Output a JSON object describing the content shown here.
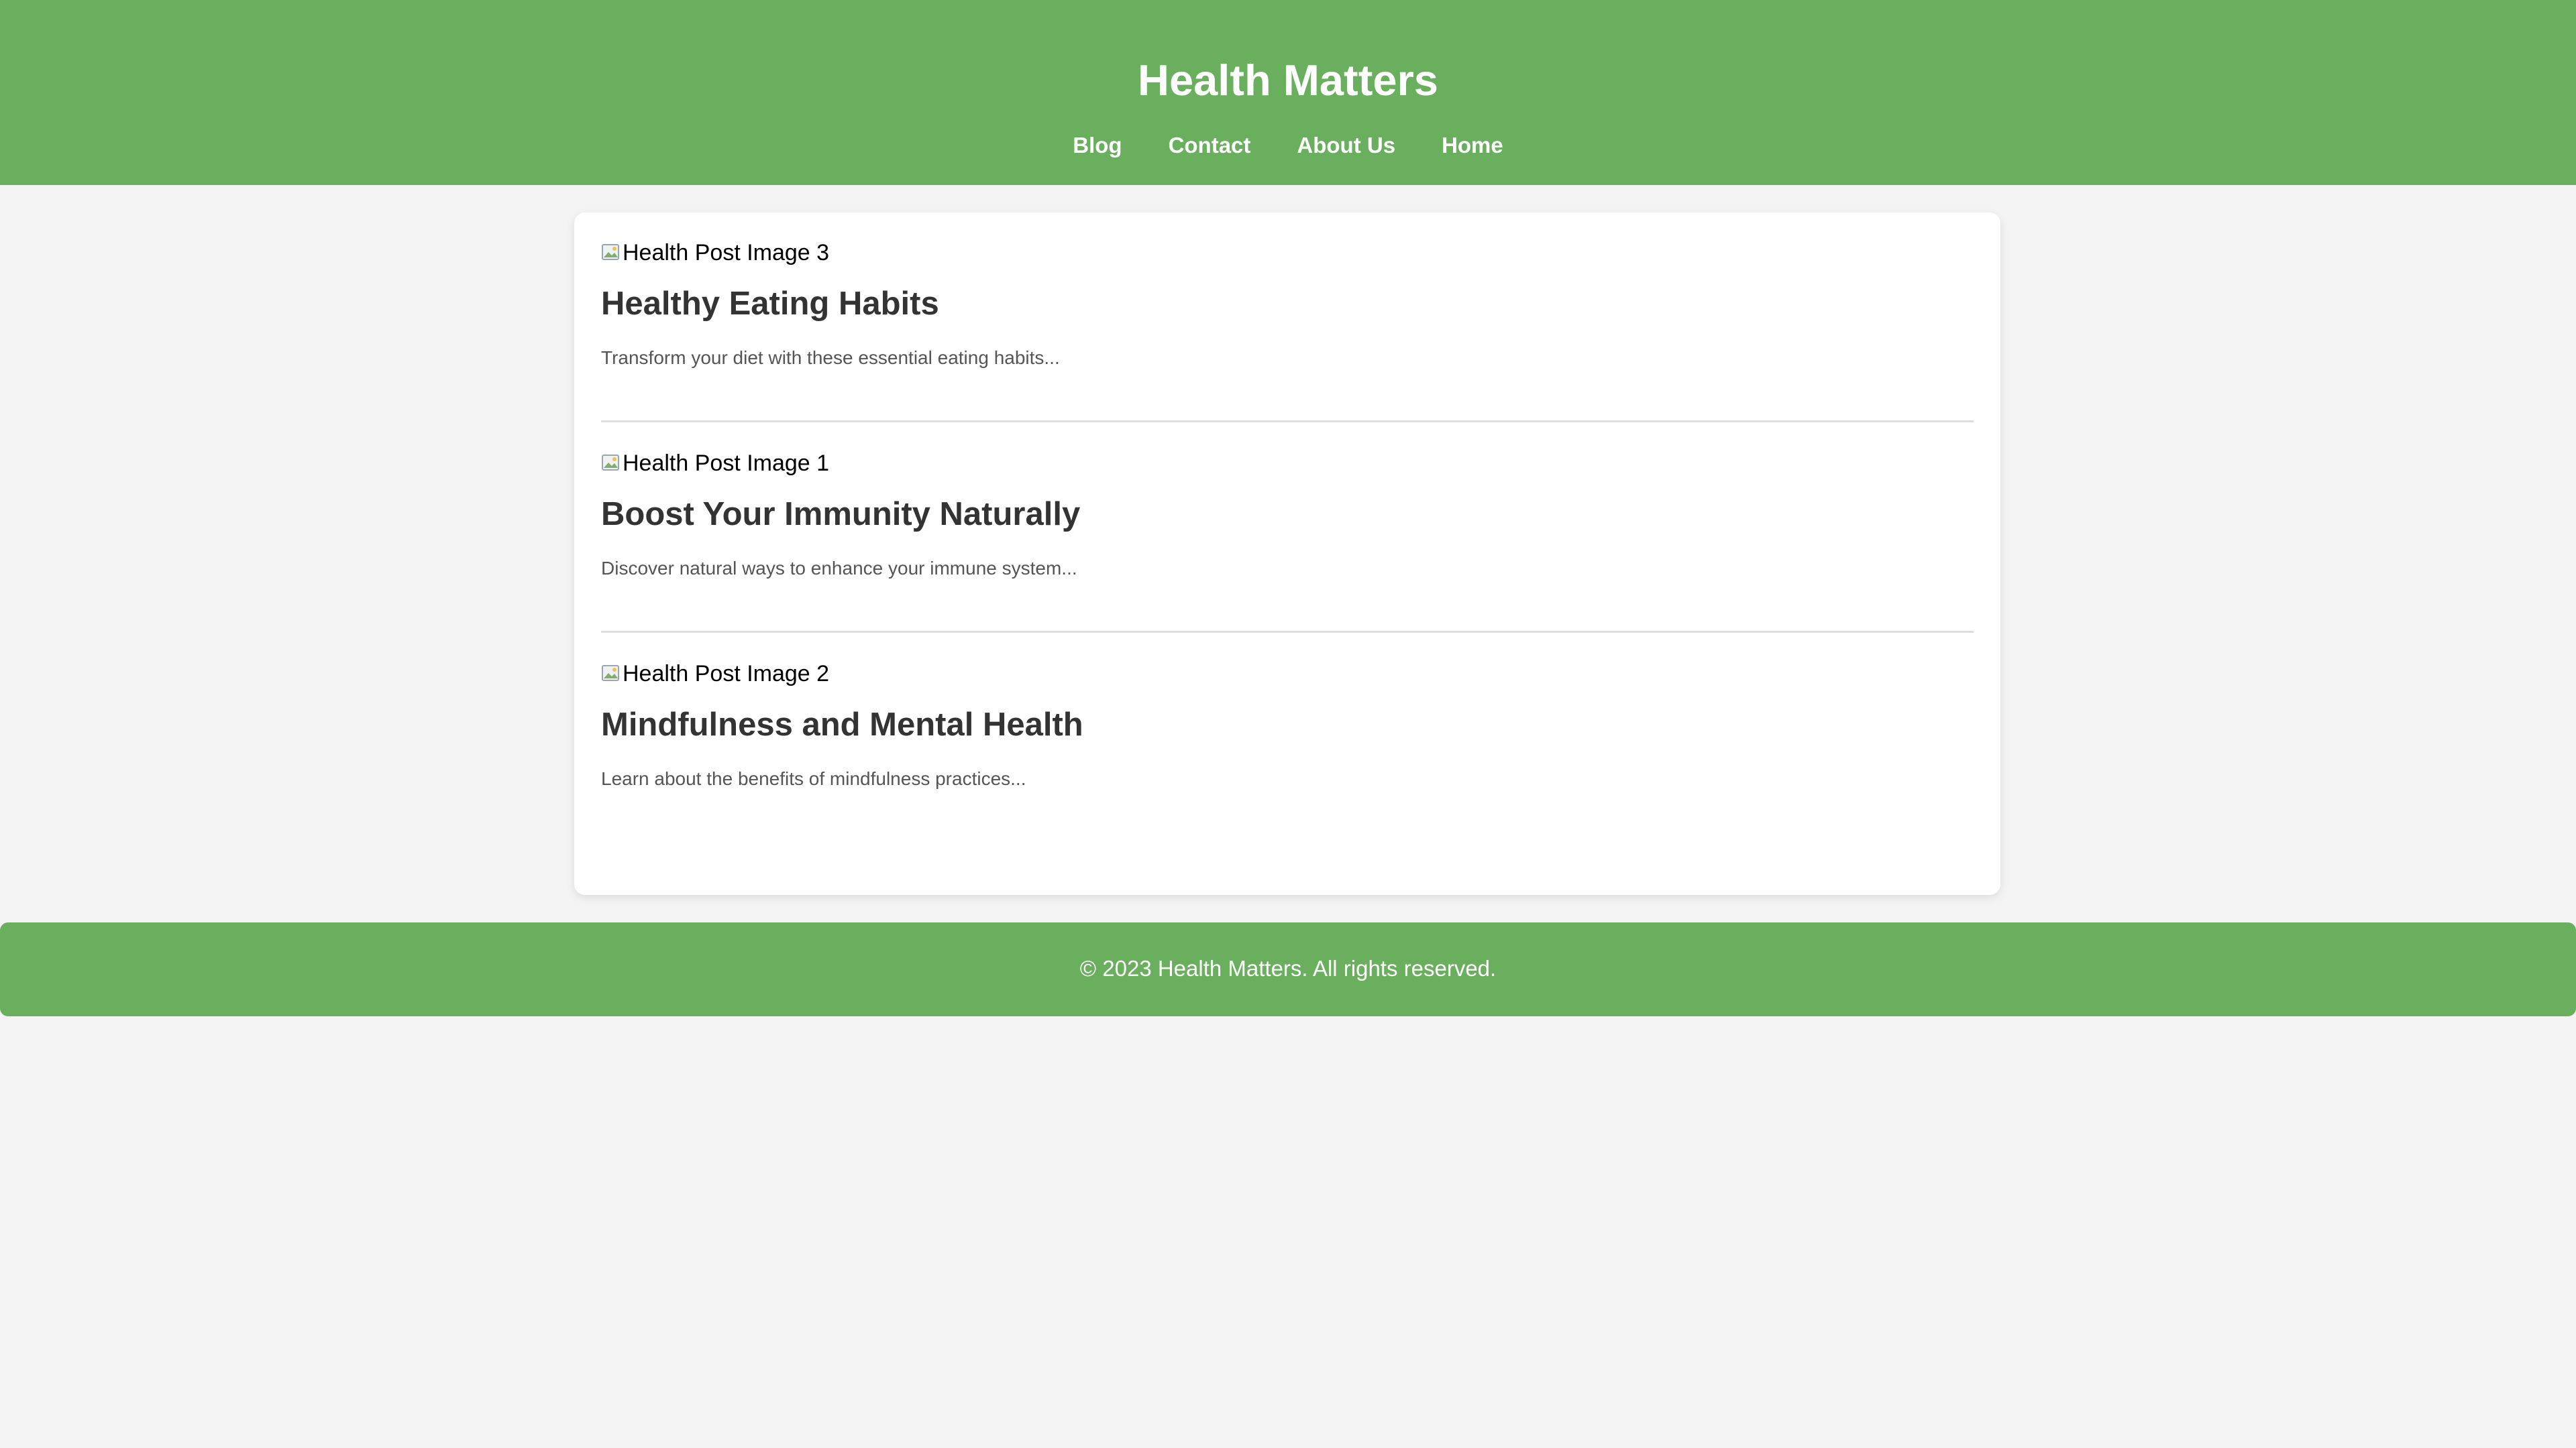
{
  "header": {
    "title": "Health Matters",
    "nav": [
      {
        "label": "Blog"
      },
      {
        "label": "Contact"
      },
      {
        "label": "About Us"
      },
      {
        "label": "Home"
      }
    ]
  },
  "posts": [
    {
      "image_alt": "Health Post Image 3",
      "title": "Healthy Eating Habits",
      "excerpt": "Transform your diet with these essential eating habits..."
    },
    {
      "image_alt": "Health Post Image 1",
      "title": "Boost Your Immunity Naturally",
      "excerpt": "Discover natural ways to enhance your immune system..."
    },
    {
      "image_alt": "Health Post Image 2",
      "title": "Mindfulness and Mental Health",
      "excerpt": "Learn about the benefits of mindfulness practices..."
    }
  ],
  "footer": {
    "text": "© 2023 Health Matters. All rights reserved."
  },
  "colors": {
    "brand_green": "#6aaf5e",
    "page_background": "#f4f4f4",
    "title_text": "#333333",
    "excerpt_text": "#555555"
  },
  "icons": {
    "broken_image": "broken-image-icon"
  }
}
